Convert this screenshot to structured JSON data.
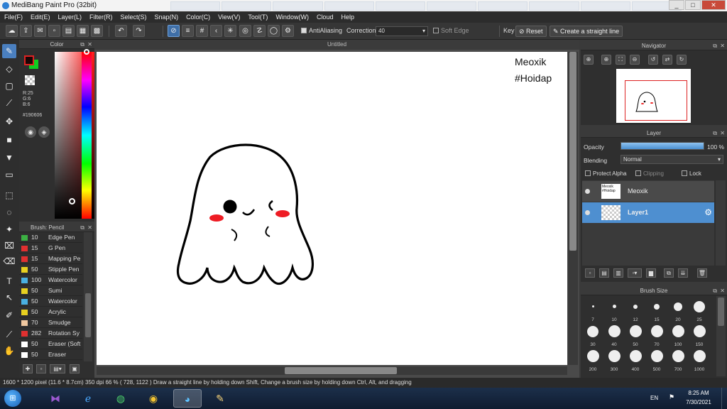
{
  "window": {
    "title": "MediBang Paint Pro (32bit)",
    "min": "_",
    "max": "□",
    "close": "✕"
  },
  "menu": [
    "File(F)",
    "Edit(E)",
    "Layer(L)",
    "Filter(R)",
    "Select(S)",
    "Snap(N)",
    "Color(C)",
    "View(V)",
    "Tool(T)",
    "Window(W)",
    "Cloud",
    "Help"
  ],
  "toolbar": {
    "antialias_label": "AntiAliasing",
    "correction_label": "Correction",
    "correction_value": "40",
    "soft_edge_label": "Soft Edge",
    "key_label": "Key",
    "reset_label": "Reset",
    "straight_line_label": "Create a straight line"
  },
  "color_panel": {
    "title": "Color",
    "r": "R:25",
    "g": "G:6",
    "b": "B:6",
    "hex": "#190606",
    "fg": "#190606",
    "bg": "#10d020"
  },
  "brush_panel": {
    "title": "Brush: Pencil",
    "items": [
      {
        "size": "10",
        "name": "Edge Pen",
        "color": "#3cb043"
      },
      {
        "size": "15",
        "name": "G Pen",
        "color": "#e03030"
      },
      {
        "size": "15",
        "name": "Mapping Pe",
        "color": "#e03030"
      },
      {
        "size": "50",
        "name": "Stipple Pen",
        "color": "#e8d020"
      },
      {
        "size": "100",
        "name": "Watercolor",
        "color": "#4ab0e0"
      },
      {
        "size": "50",
        "name": "Sumi",
        "color": "#e8d020"
      },
      {
        "size": "50",
        "name": "Watercolor",
        "color": "#4ab0e0"
      },
      {
        "size": "50",
        "name": "Acrylic",
        "color": "#e8d020"
      },
      {
        "size": "70",
        "name": "Smudge",
        "color": "#f0c8a0"
      },
      {
        "size": "282",
        "name": "Rotation Sy",
        "color": "#e03030"
      },
      {
        "size": "50",
        "name": "Eraser (Soft",
        "color": "#ffffff"
      },
      {
        "size": "50",
        "name": "Eraser",
        "color": "#ffffff"
      }
    ]
  },
  "canvas": {
    "title": "Untitled",
    "watermark_line1": "Meoxik",
    "watermark_line2": "#Hoidap"
  },
  "navigator": {
    "title": "Navigator"
  },
  "layer_panel": {
    "title": "Layer",
    "opacity_label": "Opacity",
    "opacity_value": "100 %",
    "opacity_fraction": 1.0,
    "blending_label": "Blending",
    "blending_value": "Normal",
    "protect_alpha": "Protect Alpha",
    "clipping": "Clipping",
    "lock": "Lock",
    "layers": [
      {
        "name": "Meoxik",
        "thumb_text1": "Meoxik",
        "thumb_text2": "#Hoidap",
        "selected": false
      },
      {
        "name": "Layer1",
        "selected": true
      }
    ]
  },
  "brush_size_panel": {
    "title": "Brush Size",
    "sizes": [
      "7",
      "10",
      "12",
      "15",
      "20",
      "25",
      "30",
      "40",
      "50",
      "70",
      "100",
      "150",
      "200",
      "300",
      "400",
      "500",
      "700",
      "1000"
    ]
  },
  "status": {
    "dimensions": "1600 * 1200 pixel",
    "physical": "(11.6 * 8.7cm)",
    "dpi": "350 dpi",
    "zoom": "66 %",
    "coords": "( 728, 1122 )",
    "hint": "Draw a straight line by holding down Shift, Change a brush size by holding down Ctrl, Alt, and dragging"
  },
  "taskbar": {
    "lang": "EN",
    "time": "8:25 AM",
    "date": "7/30/2021"
  },
  "colors": {
    "accent": "#4a8fd0",
    "selected_layer": "#4e8fd0",
    "panel_bg": "#2f2f2f"
  }
}
